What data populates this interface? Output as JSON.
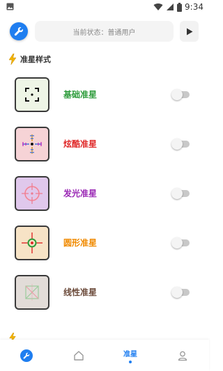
{
  "status_bar": {
    "time": "9:34",
    "icons": [
      "image-icon",
      "wifi-icon",
      "signal-icon",
      "battery-icon"
    ]
  },
  "top_bar": {
    "status_text": "当前状态：普通用户",
    "left_icon": "wrench-icon",
    "right_icon": "play-icon",
    "accent_color": "#1f7ef0"
  },
  "sections": {
    "crosshair_styles": {
      "title": "准星样式",
      "icon": "lightning-icon"
    }
  },
  "crosshairs": [
    {
      "label": "基础准星",
      "color": "#2e9c3c",
      "thumb_bg": "#eef5e6",
      "enabled": false
    },
    {
      "label": "炫酷准星",
      "color": "#e02a2a",
      "thumb_bg": "#f6d3d6",
      "enabled": false
    },
    {
      "label": "发光准星",
      "color": "#9b2ab5",
      "thumb_bg": "#e0c8ec",
      "enabled": false
    },
    {
      "label": "圆形准星",
      "color": "#f08a00",
      "thumb_bg": "#f7e3c6",
      "enabled": false
    },
    {
      "label": "线性准星",
      "color": "#6b4a3a",
      "thumb_bg": "#e2dcd8",
      "enabled": false
    }
  ],
  "bottom_nav": {
    "items": [
      {
        "icon": "wrench-icon",
        "label": "",
        "active": false
      },
      {
        "icon": "home-icon",
        "label": "",
        "active": false
      },
      {
        "icon": "",
        "label": "准星",
        "active": true
      },
      {
        "icon": "user-icon",
        "label": "",
        "active": false
      }
    ]
  }
}
